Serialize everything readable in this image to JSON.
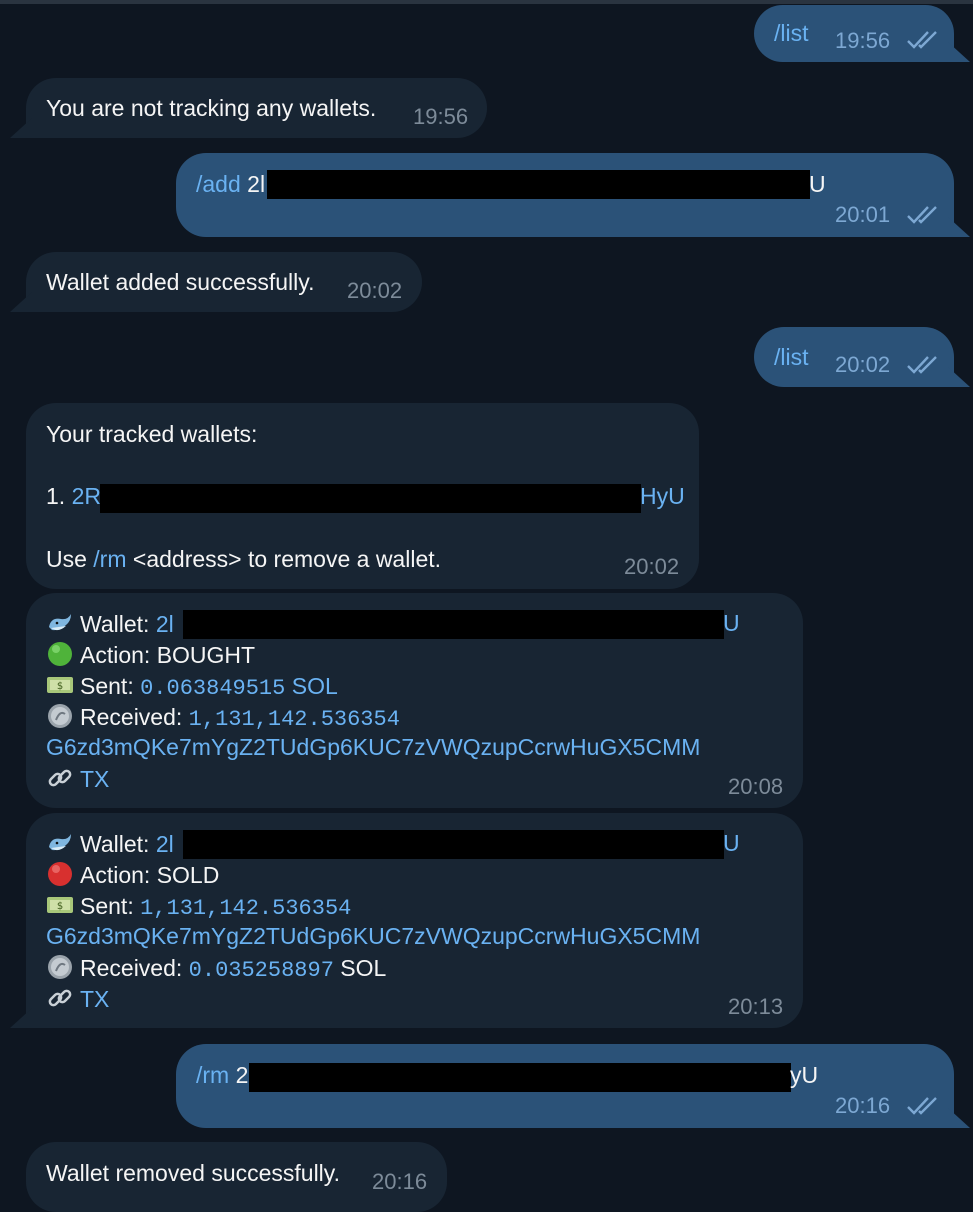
{
  "messages": [
    {
      "text": "/list",
      "time": "19:56"
    },
    {
      "text": "You are not tracking any wallets.",
      "time": "19:56"
    },
    {
      "cmd": "/add",
      "addr_start": "2l",
      "addr_end": "U",
      "time": "20:01"
    },
    {
      "text": "Wallet added successfully.",
      "time": "20:02"
    },
    {
      "text": "/list",
      "time": "20:02"
    },
    {
      "header": "Your tracked wallets:",
      "item_num": "1.",
      "addr_start": "2R",
      "addr_end": "HyU",
      "hint_pre": "Use",
      "hint_cmd": "/rm",
      "hint_post": "<address> to remove a wallet.",
      "time": "20:02"
    },
    {
      "wallet_label": "Wallet:",
      "wallet_start": "2l",
      "wallet_end": "U",
      "action": "Action: BOUGHT",
      "sent_label": "Sent:",
      "sent_value": "0.063849515",
      "sent_unit": "SOL",
      "recv_label": "Received:",
      "recv_value": "1,131,142.536354",
      "token": "G6zd3mQKe7mYgZ2TUdGp6KUC7zVWQzupCcrwHuGX5CMM",
      "tx": "TX",
      "time": "20:08"
    },
    {
      "wallet_label": "Wallet:",
      "wallet_start": "2l",
      "wallet_end": "U",
      "action": "Action: SOLD",
      "sent_label": "Sent:",
      "sent_value": "1,131,142.536354",
      "token": "G6zd3mQKe7mYgZ2TUdGp6KUC7zVWQzupCcrwHuGX5CMM",
      "recv_label": "Received:",
      "recv_value": "0.035258897",
      "recv_unit": "SOL",
      "tx": "TX",
      "time": "20:13"
    },
    {
      "cmd": "/rm",
      "addr_start": "2",
      "addr_end": "yU",
      "time": "20:16"
    },
    {
      "text": "Wallet removed successfully.",
      "time": "20:16"
    }
  ],
  "colors": {
    "background": "#0e1621",
    "incoming_bubble": "#182533",
    "outgoing_bubble": "#2b5278",
    "link": "#6ab2f2"
  },
  "icons": [
    "whale-icon",
    "green-circle-icon",
    "red-circle-icon",
    "money-icon",
    "coin-icon",
    "link-icon",
    "double-check-icon"
  ]
}
